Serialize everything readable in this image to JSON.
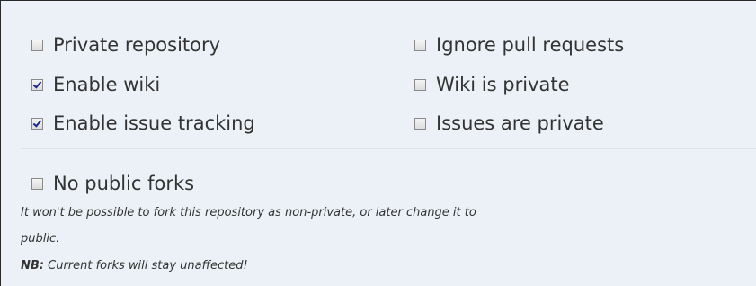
{
  "options": {
    "private_repository": {
      "label": "Private repository",
      "checked": false
    },
    "enable_wiki": {
      "label": "Enable wiki",
      "checked": true
    },
    "enable_issue_tracking": {
      "label": "Enable issue tracking",
      "checked": true
    },
    "ignore_pull_requests": {
      "label": "Ignore pull requests",
      "checked": false
    },
    "wiki_is_private": {
      "label": "Wiki is private",
      "checked": false
    },
    "issues_are_private": {
      "label": "Issues are private",
      "checked": false
    },
    "no_public_forks": {
      "label": "No public forks",
      "checked": false
    }
  },
  "help": {
    "line1": "It won't be possible to fork this repository as non-private, or later change it to",
    "line2": "public.",
    "nb_label": "NB:",
    "nb_text": " Current forks will stay unaffected!"
  },
  "colors": {
    "panel_background": "#ebf1f6",
    "text": "#333333",
    "checkmark": "#1a2a8a"
  }
}
